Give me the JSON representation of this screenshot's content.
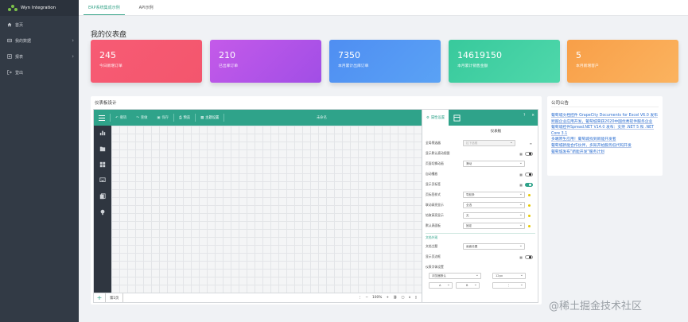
{
  "app": {
    "brand": "Wyn Integration"
  },
  "sidebar": {
    "items": [
      {
        "label": "首页",
        "icon": "home-icon"
      },
      {
        "label": "我的数据",
        "icon": "data-icon",
        "expandable": true
      },
      {
        "label": "报表",
        "icon": "report-icon",
        "expandable": true
      },
      {
        "label": "登出",
        "icon": "logout-icon"
      }
    ]
  },
  "tabs": [
    {
      "label": "ERP系统集成示例",
      "active": true
    },
    {
      "label": "API示例",
      "active": false
    }
  ],
  "page_title": "我的仪表盘",
  "cards": [
    {
      "value": "245",
      "label": "今日新增订单",
      "color": "#f3566d"
    },
    {
      "value": "210",
      "label": "已出库订单",
      "color": "#bc52e8"
    },
    {
      "value": "7350",
      "label": "本月累计出库订单",
      "color": "#4f8ef2"
    },
    {
      "value": "14619150",
      "label": "本月累计销售金额",
      "color": "#3ccc9f"
    },
    {
      "value": "5",
      "label": "本月新增客户",
      "color": "#f9a24c"
    }
  ],
  "designer": {
    "title": "仪表板设计",
    "toolbar": {
      "items": [
        "撤销",
        "重做",
        "保存",
        "预览",
        "主题设置"
      ],
      "center_title": "未命名"
    },
    "page_tab": "第1页",
    "zoom": "100%",
    "props": {
      "tab_selected": "属性设置",
      "subtitle": "仪表板",
      "rows": [
        {
          "label": "全局筛选器",
          "value": "拉下选框"
        },
        {
          "label": "显示默认滚动视图",
          "value": ""
        },
        {
          "label": "页面切换动画",
          "value": "滑动"
        },
        {
          "label": "自动播放",
          "value": ""
        },
        {
          "label": "显示页标签",
          "value": ""
        },
        {
          "label": "页标签样式",
          "value": "导航条"
        },
        {
          "label": "联动高亮显示",
          "value": "全选"
        },
        {
          "label": "钻取高亮显示",
          "value": "无"
        },
        {
          "label": "默认表面板",
          "value": "固定"
        }
      ],
      "section": "文档外观",
      "rows2": [
        {
          "label": "文档主题",
          "value": "画面设置"
        },
        {
          "label": "显示页边框",
          "value": ""
        },
        {
          "label": "仪表字体设置",
          "value": ""
        }
      ],
      "font_value": "浏览器默认",
      "font_size": "12px"
    }
  },
  "news": {
    "title": "公司公告",
    "items": [
      "葡萄城文档控件 GrapeCity Documents for Excel V6.0 发布",
      "跨越企业应用开发，葡萄城荣获2020中国优秀软件服务企业",
      "葡萄城控件Spread.NET V14.0 发布：支持 .NET 5 和 .NET Core 3.1",
      "多端原生应用！葡萄城找到新能开发者",
      "葡萄城新能合作伙伴，多知开始服务低代码开发",
      "葡萄城发布\"新能开发\"服务计划"
    ]
  },
  "watermark": "@稀土掘金技术社区"
}
